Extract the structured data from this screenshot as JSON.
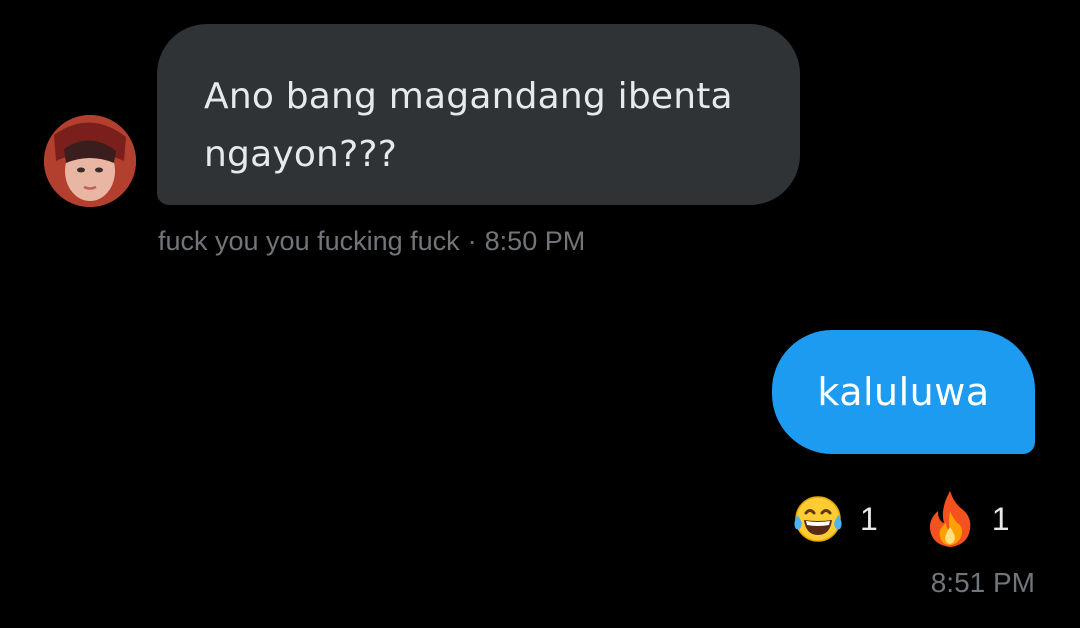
{
  "incoming": {
    "text": "Ano bang magandang ibenta ngayon???",
    "sender": "fuck you you fucking fuck",
    "separator": "·",
    "time": "8:50 PM"
  },
  "outgoing": {
    "text": "kaluluwa",
    "time": "8:51 PM",
    "reactions": [
      {
        "icon": "laughing-tears-emoji-icon",
        "count": "1"
      },
      {
        "icon": "fire-emoji-icon",
        "count": "1"
      }
    ]
  },
  "colors": {
    "background": "#000000",
    "incoming_bubble": "#2f3336",
    "outgoing_bubble": "#1d9bf0",
    "meta_text": "#71767b"
  }
}
